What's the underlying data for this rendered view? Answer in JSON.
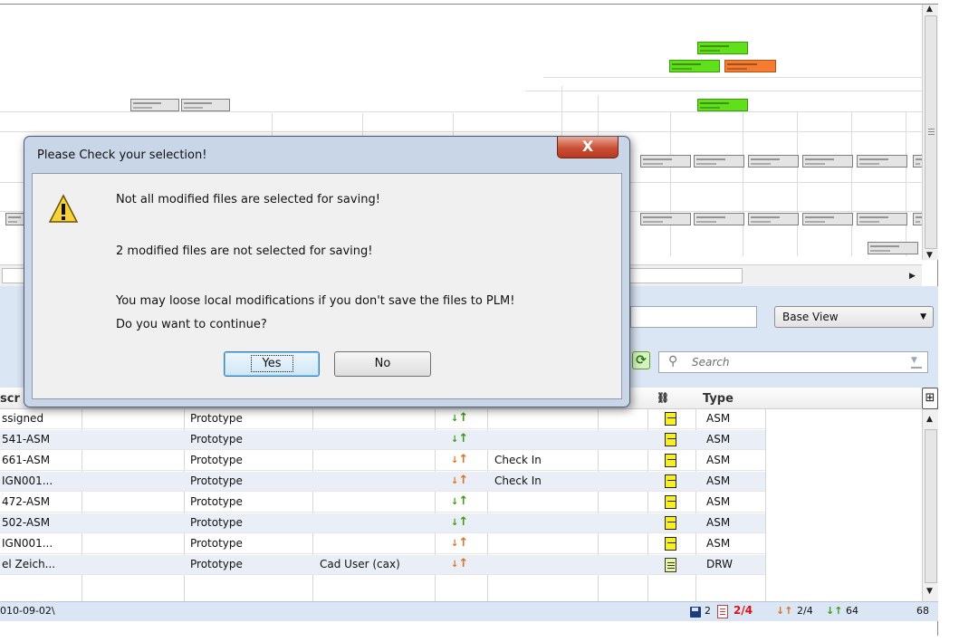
{
  "dialog": {
    "title": "Please Check your selection!",
    "close_glyph": "X",
    "line1": "Not all modified files are selected for saving!",
    "line2": "2 modified files are not selected for saving!",
    "line3": "You may loose local modifications if you don't save the files to PLM!",
    "line4": "Do you want to continue?",
    "yes_label": "Yes",
    "no_label": "No",
    "icon": "warning-icon"
  },
  "toolbar": {
    "view_select": "Base View",
    "search_placeholder": "Search"
  },
  "table": {
    "headers": {
      "type": "Type",
      "partial": "scr"
    },
    "rows": [
      {
        "name": "ssigned",
        "status": "Prototype",
        "owner": "",
        "arrow": "green",
        "action": "",
        "icon": "cube",
        "type": "ASM"
      },
      {
        "name": "541-ASM",
        "status": "Prototype",
        "owner": "",
        "arrow": "green",
        "action": "",
        "icon": "cube",
        "type": "ASM"
      },
      {
        "name": "661-ASM",
        "status": "Prototype",
        "owner": "",
        "arrow": "orange",
        "action": "Check In",
        "icon": "cube",
        "type": "ASM"
      },
      {
        "name": "IGN001...",
        "status": "Prototype",
        "owner": "",
        "arrow": "orange",
        "action": "Check In",
        "icon": "cube",
        "type": "ASM"
      },
      {
        "name": "472-ASM",
        "status": "Prototype",
        "owner": "",
        "arrow": "green",
        "action": "",
        "icon": "cube",
        "type": "ASM"
      },
      {
        "name": "502-ASM",
        "status": "Prototype",
        "owner": "",
        "arrow": "green",
        "action": "",
        "icon": "cube",
        "type": "ASM"
      },
      {
        "name": "IGN001...",
        "status": "Prototype",
        "owner": "",
        "arrow": "orange",
        "action": "",
        "icon": "cube",
        "type": "ASM"
      },
      {
        "name": "el Zeich...",
        "status": "Prototype",
        "owner": "Cad User (cax)",
        "arrow": "orange",
        "action": "",
        "icon": "drawing",
        "type": "DRW"
      }
    ]
  },
  "status_bar": {
    "path": "010-09-02\\",
    "saved_count": "2",
    "modified": "2/4",
    "checkin": "2/4",
    "uptodate": "64",
    "total": "68"
  },
  "colors": {
    "accent_blue": "#dbe6f4",
    "node_green": "#5fe01a",
    "node_orange": "#f47b30",
    "close_red": "#c94f35"
  }
}
